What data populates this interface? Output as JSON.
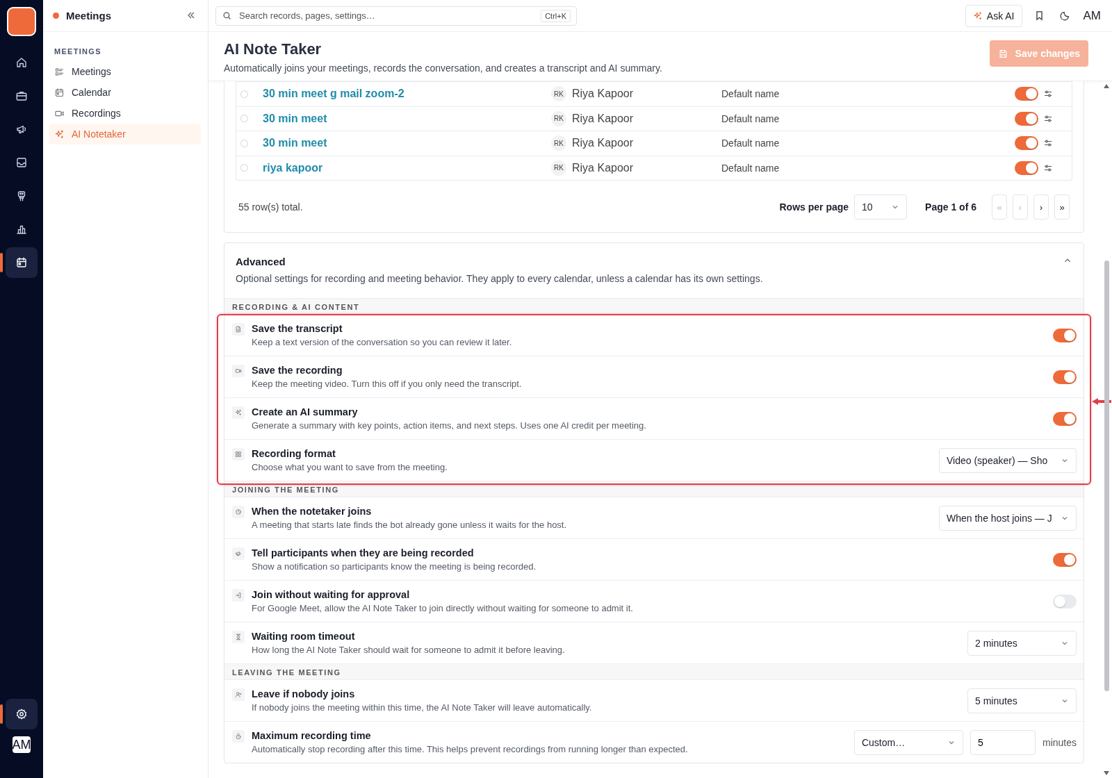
{
  "rail": {
    "items": [
      {
        "selected": false
      },
      {
        "selected": false
      },
      {
        "selected": false
      },
      {
        "selected": false
      },
      {
        "selected": false
      },
      {
        "selected": false
      },
      {
        "selected": true
      }
    ],
    "bottom": [
      {
        "selected": true
      }
    ],
    "avatar": "AM"
  },
  "sidebar": {
    "title": "Meetings",
    "section": "MEETINGS",
    "items": [
      {
        "label": "Meetings",
        "selected": false
      },
      {
        "label": "Calendar",
        "selected": false
      },
      {
        "label": "Recordings",
        "selected": false
      },
      {
        "label": "AI Notetaker",
        "selected": true
      }
    ]
  },
  "topbar": {
    "search": {
      "placeholder": "Search records, pages, settings…",
      "shortcut": "Ctrl+K"
    },
    "ask_ai": "Ask AI",
    "avatar": "AM"
  },
  "page": {
    "title": "AI Note Taker",
    "description": "Automatically joins your meetings, records the conversation, and creates a transcript and AI summary.",
    "save": {
      "label": "Save changes",
      "disabled": true
    }
  },
  "table": {
    "rows": [
      {
        "selected": false,
        "name": "30 min meet g mail zoom-2",
        "initials": "RK",
        "owner": "Riya Kapoor",
        "template": "Default name",
        "enabled": true
      },
      {
        "selected": false,
        "name": "30 min meet",
        "initials": "RK",
        "owner": "Riya Kapoor",
        "template": "Default name",
        "enabled": true
      },
      {
        "selected": false,
        "name": "30 min meet",
        "initials": "RK",
        "owner": "Riya Kapoor",
        "template": "Default name",
        "enabled": true
      },
      {
        "selected": false,
        "name": "riya kapoor",
        "initials": "RK",
        "owner": "Riya Kapoor",
        "template": "Default name",
        "enabled": true
      }
    ],
    "total": "55 row(s) total.",
    "rows_per_page_label": "Rows per page",
    "rows_per_page": "10",
    "page_info": "Page 1 of 6",
    "pager": [
      {
        "label": "«",
        "disabled": true
      },
      {
        "label": "‹",
        "disabled": true
      },
      {
        "label": "›",
        "disabled": false
      },
      {
        "label": "»",
        "disabled": false
      }
    ]
  },
  "advanced": {
    "title": "Advanced",
    "description": "Optional settings for recording and meeting behavior. They apply to every calendar, unless a calendar has its own settings.",
    "expanded": true,
    "sections": [
      {
        "title": "RECORDING & AI CONTENT",
        "highlighted": true,
        "rows": [
          {
            "kind": "toggle",
            "title": "Save the transcript",
            "description": "Keep a text version of the conversation so you can review it later.",
            "on": true
          },
          {
            "kind": "toggle",
            "title": "Save the recording",
            "description": "Keep the meeting video. Turn this off if you only need the transcript.",
            "on": true
          },
          {
            "kind": "toggle",
            "title": "Create an AI summary",
            "description": "Generate a summary with key points, action items, and next steps. Uses one AI credit per meeting.",
            "on": true
          },
          {
            "kind": "select",
            "title": "Recording format",
            "description": "Choose what you want to save from the meeting.",
            "value": "Video (speaker) — Sho"
          }
        ]
      },
      {
        "title": "JOINING THE MEETING",
        "highlighted": false,
        "rows": [
          {
            "kind": "select",
            "title": "When the notetaker joins",
            "description": "A meeting that starts late finds the bot already gone unless it waits for the host.",
            "value": "When the host joins — J"
          },
          {
            "kind": "toggle",
            "title": "Tell participants when they are being recorded",
            "description": "Show a notification so participants know the meeting is being recorded.",
            "on": true
          },
          {
            "kind": "toggle",
            "title": "Join without waiting for approval",
            "description": "For Google Meet, allow the AI Note Taker to join directly without waiting for someone to admit it.",
            "on": false
          },
          {
            "kind": "select",
            "title": "Waiting room timeout",
            "description": "How long the AI Note Taker should wait for someone to admit it before leaving.",
            "value": "2 minutes"
          }
        ]
      },
      {
        "title": "LEAVING THE MEETING",
        "highlighted": false,
        "rows": [
          {
            "kind": "select",
            "title": "Leave if nobody joins",
            "description": "If nobody joins the meeting within this time, the AI Note Taker will leave automatically.",
            "value": "5 minutes"
          },
          {
            "kind": "select_input",
            "title": "Maximum recording time",
            "description": "Automatically stop recording after this time. This helps prevent recordings from running longer than expected.",
            "value": "Custom…",
            "input": "5",
            "unit": "minutes"
          }
        ]
      }
    ]
  }
}
